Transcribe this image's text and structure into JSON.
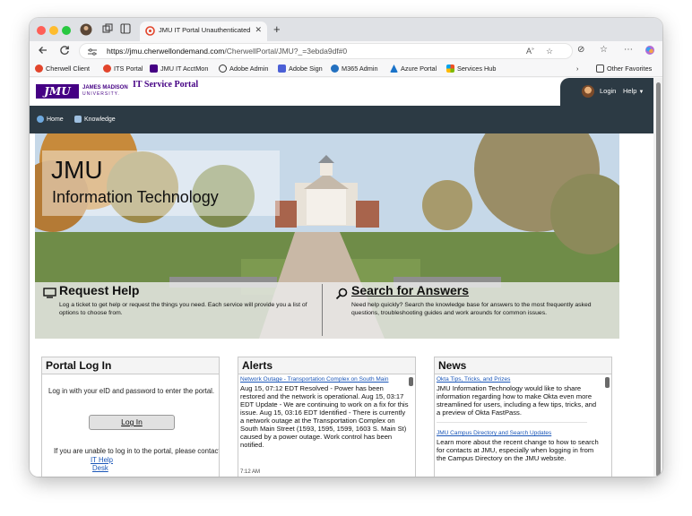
{
  "browser": {
    "tab_title": "JMU IT Portal Unauthenticated",
    "url_host": "https://jmu.cherwellondemand.com",
    "url_path": "/CherwellPortal/JMU?_=3ebda9df#0",
    "favorites": [
      {
        "label": "Cherwell Client",
        "color": "#e2452c"
      },
      {
        "label": "ITS Portal",
        "color": "#e2452c"
      },
      {
        "label": "JMU IT AcctMon",
        "color": "#450084"
      },
      {
        "label": "Adobe Admin",
        "color": "#333333"
      },
      {
        "label": "Adobe Sign",
        "color": "#4b5fd6"
      },
      {
        "label": "M365 Admin",
        "color": "#2370c0"
      },
      {
        "label": "Azure Portal",
        "color": "#1a73c9"
      },
      {
        "label": "Services Hub",
        "color": "#e34a2b"
      }
    ],
    "other_favorites": "Other Favorites"
  },
  "header": {
    "logo_text": "JMU",
    "university_name_line1": "JAMES MADISON",
    "university_name_line2": "UNIVERSITY.",
    "portal_title": "IT Service Portal",
    "login_label": "Login",
    "help_label": "Help"
  },
  "nav": {
    "home": "Home",
    "knowledge": "Knowledge"
  },
  "hero": {
    "title_line1": "JMU",
    "title_line2": "Information Technology",
    "request_help_title": "Request Help",
    "request_help_desc": "Log a ticket to get help or request the things you need. Each service will provide you a list of options to choose from.",
    "search_title": "Search for Answers",
    "search_desc": "Need help quickly? Search the knowledge base for answers to the most frequently asked questions, troubleshooting guides and work arounds for common issues."
  },
  "portal_login": {
    "title": "Portal Log In",
    "instructions": "Log in with your eID and password to enter the portal.",
    "button_label": "Log In",
    "help_line": "If you are unable to log in to the portal, please contact the",
    "help_link_line1": "IT Help",
    "help_link_line2": "Desk"
  },
  "alerts": {
    "title": "Alerts",
    "link": "Network Outage - Transportation Complex on South Main",
    "body": "Aug 15, 07:12 EDT Resolved - Power has been restored and the network is operational. Aug 15, 03:17 EDT Update - We are continuing to work on a fix for this issue. Aug 15, 03:16 EDT Identified - There is currently a network outage at the Transportation Complex on South Main Street (1593, 1595, 1599, 1603 S. Main St) caused by a power outage. Work control has been notified.",
    "time": "7:12 AM"
  },
  "news": {
    "title": "News",
    "items": [
      {
        "link": "Okta Tips, Tricks, and Prizes",
        "body": "JMU Information Technology would like to share information regarding how to make Okta even more streamlined for users, including a few tips, tricks, and a preview of Okta FastPass."
      },
      {
        "link": "JMU Campus Directory and Search Updates",
        "body": "Learn more about the recent change to how to search for contacts at JMU, especially when logging in from the Campus Directory on the JMU website."
      }
    ]
  },
  "colors": {
    "jmu_purple": "#450084",
    "nav_dark": "#2c3a44",
    "link_blue": "#1a56b8"
  }
}
